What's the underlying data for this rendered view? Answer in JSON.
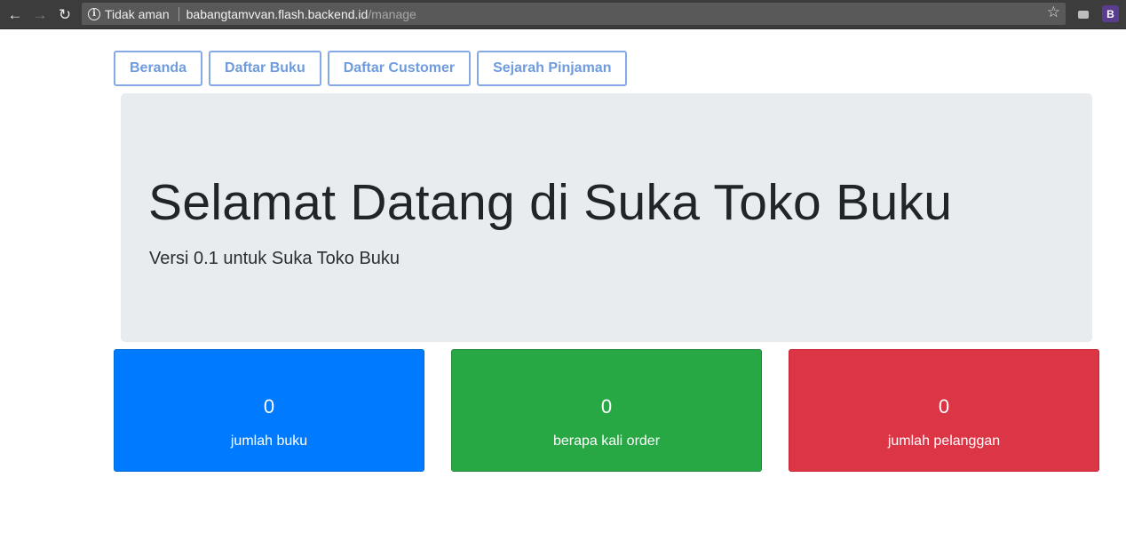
{
  "browser": {
    "security_label": "Tidak aman",
    "url_host": "babangtamvvan.flash.backend.id",
    "url_path": "/manage",
    "extension_badge": "B",
    "icons": [
      "back-arrow-icon",
      "forward-arrow-icon",
      "reload-icon",
      "info-icon",
      "star-icon",
      "cast-icon"
    ]
  },
  "nav": {
    "items": [
      {
        "label": "Beranda"
      },
      {
        "label": "Daftar Buku"
      },
      {
        "label": "Daftar Customer"
      },
      {
        "label": "Sejarah Pinjaman"
      }
    ],
    "border_color": "#84a9e6",
    "text_color": "#6f9be0"
  },
  "jumbotron": {
    "title": "Selamat Datang di Suka Toko Buku",
    "lead": "Versi 0.1 untuk Suka Toko Buku"
  },
  "stats": [
    {
      "value": "0",
      "label": "jumlah buku",
      "color": "#007bff"
    },
    {
      "value": "0",
      "label": "berapa kali order",
      "color": "#28a745"
    },
    {
      "value": "0",
      "label": "jumlah pelanggan",
      "color": "#dc3545"
    }
  ]
}
